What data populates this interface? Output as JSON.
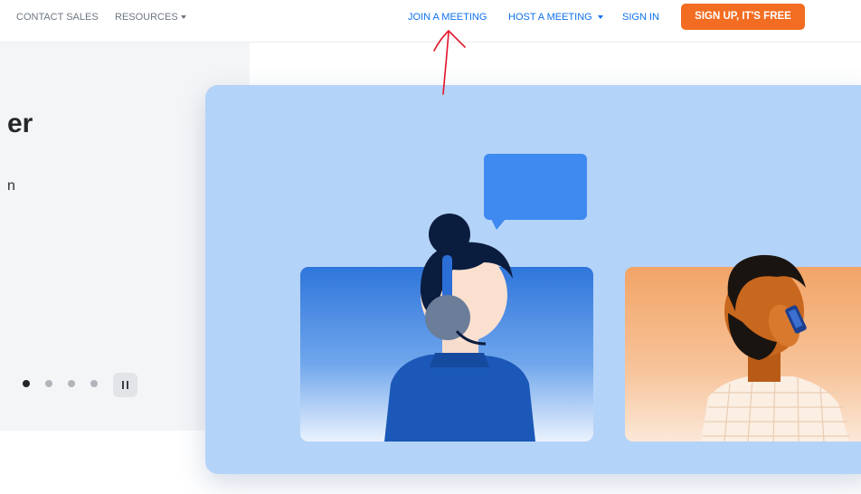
{
  "nav": {
    "contact_sales": "CONTACT SALES",
    "resources": "RESOURCES",
    "join_meeting": "JOIN A MEETING",
    "host_meeting": "HOST A MEETING",
    "sign_in": "SIGN IN",
    "signup": "SIGN UP, IT'S FREE"
  },
  "hero": {
    "title_fragment": "er",
    "subtitle_fragment": "n"
  },
  "carousel": {
    "slide_count": 4,
    "active_slide": 1
  },
  "colors": {
    "accent_blue": "#0e72ed",
    "signup_orange": "#f26d21",
    "card_bg": "#b4d3f8",
    "annotation_red": "#e0162b"
  },
  "icons": {
    "caret": "caret-down-icon",
    "pause": "pause-icon"
  }
}
